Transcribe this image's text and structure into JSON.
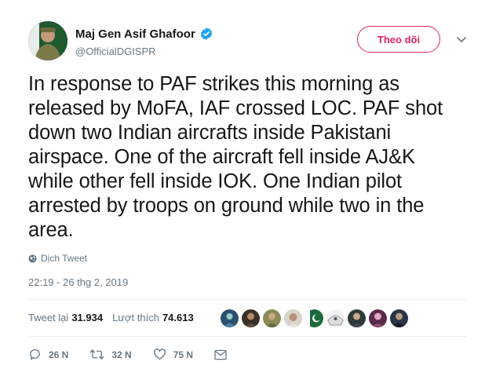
{
  "user": {
    "display_name": "Maj Gen Asif Ghafoor",
    "handle": "@OfficialDGISPR"
  },
  "follow_label": "Theo dõi",
  "tweet_text": "In response to PAF strikes this morning as released by MoFA, IAF crossed LOC. PAF shot down two Indian aircrafts inside Pakistani airspace. One of the aircraft fell inside AJ&K while other fell inside IOK. One Indian pilot arrested by troops on ground while two in the area.",
  "translate_label": "Dịch Tweet",
  "timestamp": "22:19 - 26 thg 2, 2019",
  "stats": {
    "retweets_label": "Tweet lại",
    "retweets_count": "31.934",
    "likes_label": "Lượt thích",
    "likes_count": "74.613"
  },
  "actions": {
    "replies": "26 N",
    "retweets": "32 N",
    "likes": "75 N"
  },
  "colors": {
    "accent_red": "#e0245e",
    "verified_blue": "#1da1f2",
    "muted": "#657786"
  }
}
